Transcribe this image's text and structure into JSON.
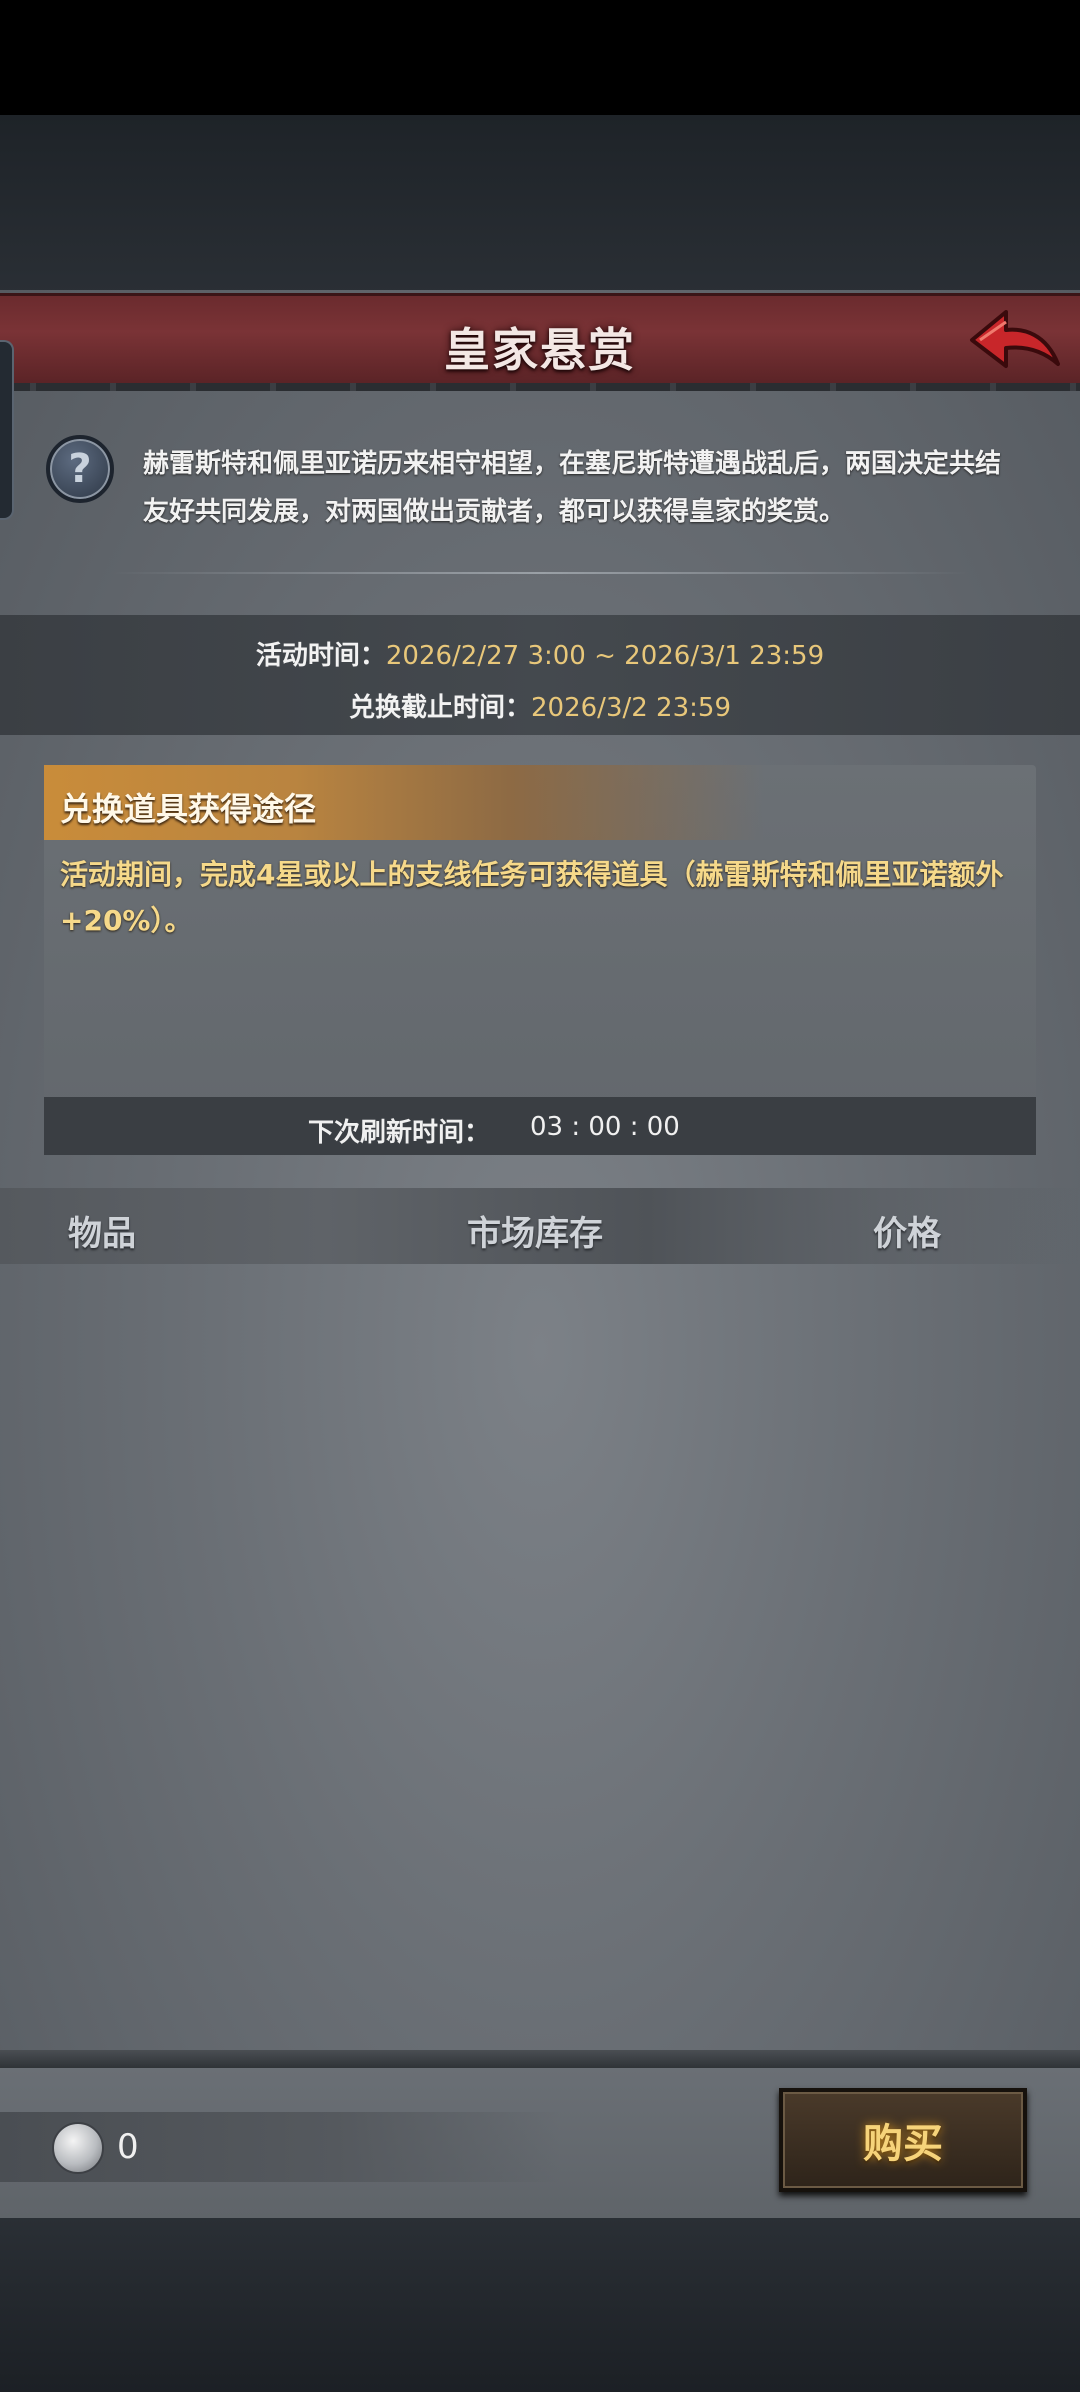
{
  "header": {
    "title": "皇家悬赏"
  },
  "intro": {
    "text": "赫雷斯特和佩里亚诺历来相守相望，在塞尼斯特遭遇战乱后，两国决定共结友好共同发展，对两国做出贡献者，都可以获得皇家的奖赏。"
  },
  "times": {
    "activity_label": "活动时间：",
    "activity_value": "2026/2/27 3:00 ~ 2026/3/1 23:59",
    "exchange_label": "兑换截止时间：",
    "exchange_value": "2026/3/2 23:59"
  },
  "source": {
    "title": "兑换道具获得途径",
    "description": "活动期间，完成4星或以上的支线任务可获得道具（赫雷斯特和佩里亚诺额外+20%）。",
    "refresh_label": "下次刷新时间：",
    "refresh_value": "03 : 00 : 00"
  },
  "table": {
    "columns": [
      "物品",
      "市场库存",
      "价格"
    ]
  },
  "footer": {
    "coin_count": "0",
    "buy_label": "购买"
  },
  "icons": {
    "help": "help-icon",
    "back": "back-arrow-icon",
    "coin": "silver-coin-icon"
  },
  "colors": {
    "title_bar": "#6b2b2e",
    "time_value": "#e8c77a",
    "source_header": "#c98c3a",
    "source_text": "#f6d98a",
    "buy_text": "#f6d37a"
  }
}
